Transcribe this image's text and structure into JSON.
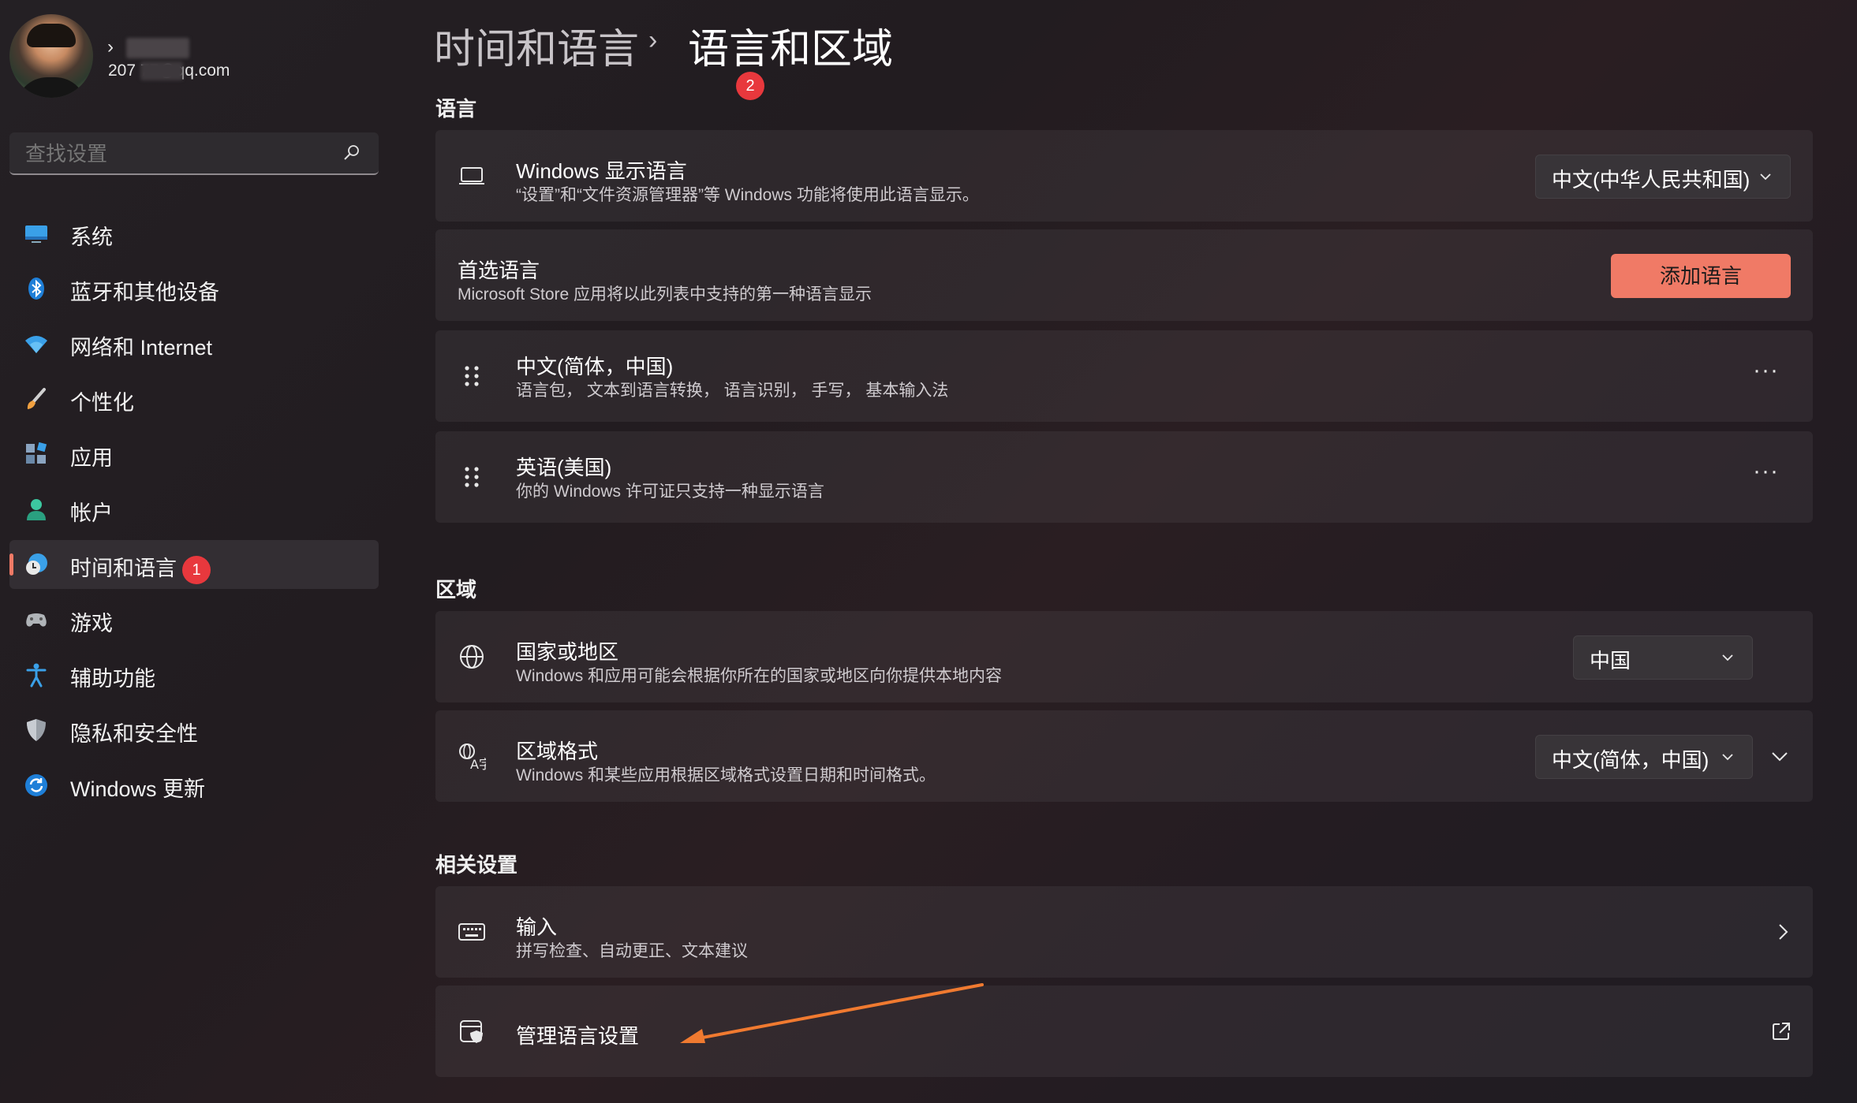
{
  "user": {
    "name": "",
    "email": "207      77@qq.com"
  },
  "search": {
    "placeholder": "查找设置"
  },
  "sidebar": {
    "items": [
      {
        "label": "系统",
        "icon": "monitor-icon"
      },
      {
        "label": "蓝牙和其他设备",
        "icon": "bluetooth-icon"
      },
      {
        "label": "网络和 Internet",
        "icon": "wifi-icon"
      },
      {
        "label": "个性化",
        "icon": "brush-icon"
      },
      {
        "label": "应用",
        "icon": "apps-icon"
      },
      {
        "label": "帐户",
        "icon": "person-icon"
      },
      {
        "label": "时间和语言",
        "icon": "time-language-icon",
        "active": true,
        "badge": "1"
      },
      {
        "label": "游戏",
        "icon": "gamepad-icon"
      },
      {
        "label": "辅助功能",
        "icon": "accessibility-icon"
      },
      {
        "label": "隐私和安全性",
        "icon": "shield-icon"
      },
      {
        "label": "Windows 更新",
        "icon": "update-icon"
      }
    ]
  },
  "breadcrumb": {
    "parent": "时间和语言",
    "separator": "›",
    "current": "语言和区域",
    "badge": "2"
  },
  "sections": {
    "language": "语言",
    "region": "区域",
    "related": "相关设置"
  },
  "display_language": {
    "title": "Windows 显示语言",
    "subtitle": "“设置”和“文件资源管理器”等 Windows 功能将使用此语言显示。",
    "value": "中文(中华人民共和国)"
  },
  "preferred_language": {
    "title": "首选语言",
    "subtitle": "Microsoft Store 应用将以此列表中支持的第一种语言显示",
    "button": "添加语言"
  },
  "languages": [
    {
      "title": "中文(简体，中国)",
      "subtitle": "语言包， 文本到语言转换， 语言识别， 手写， 基本输入法",
      "more": "···"
    },
    {
      "title": "英语(美国)",
      "subtitle": "你的 Windows 许可证只支持一种显示语言",
      "more": "···"
    }
  ],
  "country": {
    "title": "国家或地区",
    "subtitle": "Windows 和应用可能会根据你所在的国家或地区向你提供本地内容",
    "value": "中国"
  },
  "regional_format": {
    "title": "区域格式",
    "subtitle": "Windows 和某些应用根据区域格式设置日期和时间格式。",
    "value": "中文(简体，中国)"
  },
  "related": {
    "typing": {
      "title": "输入",
      "subtitle": "拼写检查、自动更正、文本建议"
    },
    "admin": {
      "title": "管理语言设置"
    }
  },
  "colors": {
    "accent": "#f07a66",
    "badge": "#e8383d",
    "annotation_arrow": "#f07a30"
  }
}
